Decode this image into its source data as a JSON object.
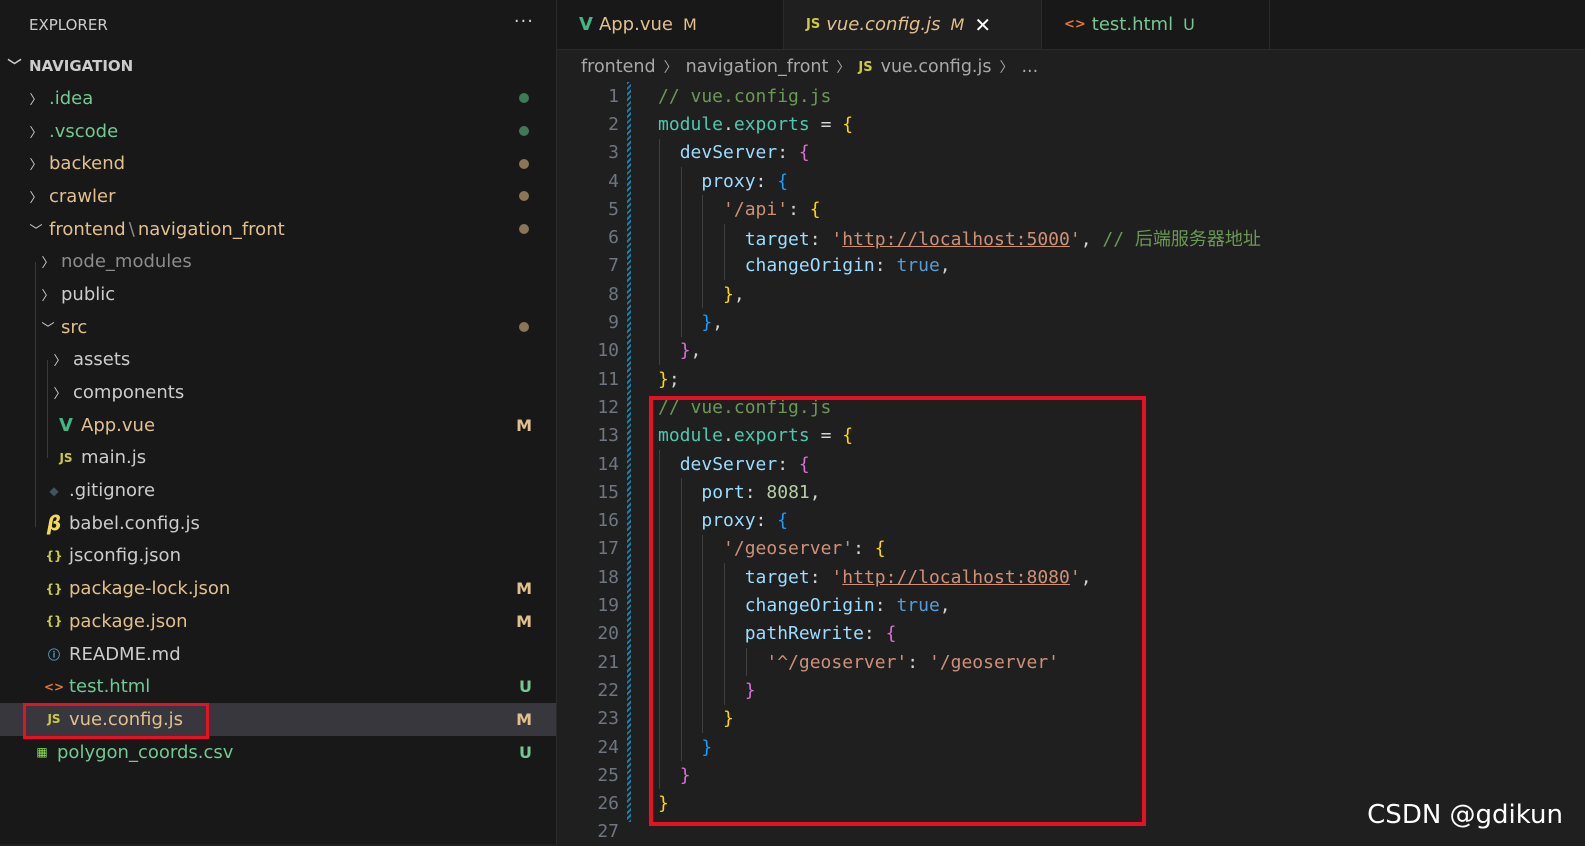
{
  "explorer": {
    "title": "EXPLORER",
    "more": "···",
    "section": "NAVIGATION",
    "items": [
      {
        "label": ".idea",
        "type": "folder",
        "depth": 0,
        "expanded": false,
        "color": "#73c991",
        "status": "dot",
        "status_color": "#3f7a56"
      },
      {
        "label": ".vscode",
        "type": "folder",
        "depth": 0,
        "expanded": false,
        "color": "#73c991",
        "status": "dot",
        "status_color": "#3f7a56"
      },
      {
        "label": "backend",
        "type": "folder",
        "depth": 0,
        "expanded": false,
        "color": "#e2c08d",
        "status": "dot",
        "status_color": "#8a7556"
      },
      {
        "label": "crawler",
        "type": "folder",
        "depth": 0,
        "expanded": false,
        "color": "#e2c08d",
        "status": "dot",
        "status_color": "#8a7556"
      },
      {
        "label": "frontend",
        "label2": "navigation_front",
        "type": "folder",
        "depth": 0,
        "expanded": true,
        "color": "#e2c08d",
        "status": "dot",
        "status_color": "#8a7556"
      },
      {
        "label": "node_modules",
        "type": "folder",
        "depth": 1,
        "expanded": false,
        "color": "#8c8c8c"
      },
      {
        "label": "public",
        "type": "folder",
        "depth": 1,
        "expanded": false,
        "color": "#cccccc"
      },
      {
        "label": "src",
        "type": "folder",
        "depth": 1,
        "expanded": true,
        "color": "#e2c08d",
        "status": "dot",
        "status_color": "#8a7556"
      },
      {
        "label": "assets",
        "type": "folder",
        "depth": 2,
        "expanded": false,
        "color": "#cccccc"
      },
      {
        "label": "components",
        "type": "folder",
        "depth": 2,
        "expanded": false,
        "color": "#cccccc"
      },
      {
        "label": "App.vue",
        "type": "file",
        "icon": "vue-icon",
        "depth": 2,
        "color": "#e2c08d",
        "status": "M"
      },
      {
        "label": "main.js",
        "type": "file",
        "icon": "js-icon",
        "depth": 2,
        "color": "#cccccc"
      },
      {
        "label": ".gitignore",
        "type": "file",
        "icon": "git-icon",
        "depth": 1,
        "color": "#cccccc"
      },
      {
        "label": "babel.config.js",
        "type": "file",
        "icon": "babel-icon",
        "depth": 1,
        "color": "#cccccc"
      },
      {
        "label": "jsconfig.json",
        "type": "file",
        "icon": "json-icon",
        "depth": 1,
        "color": "#cccccc"
      },
      {
        "label": "package-lock.json",
        "type": "file",
        "icon": "json-icon",
        "depth": 1,
        "color": "#e2c08d",
        "status": "M"
      },
      {
        "label": "package.json",
        "type": "file",
        "icon": "json-icon",
        "depth": 1,
        "color": "#e2c08d",
        "status": "M"
      },
      {
        "label": "README.md",
        "type": "file",
        "icon": "info-icon",
        "depth": 1,
        "color": "#cccccc"
      },
      {
        "label": "test.html",
        "type": "file",
        "icon": "html-icon",
        "depth": 1,
        "color": "#73c991",
        "status": "U"
      },
      {
        "label": "vue.config.js",
        "type": "file",
        "icon": "js-icon",
        "depth": 1,
        "color": "#e2c08d",
        "status": "M",
        "selected": true
      },
      {
        "label": "polygon_coords.csv",
        "type": "file",
        "icon": "csv-icon",
        "depth": 0,
        "color": "#73c991",
        "status": "U"
      }
    ]
  },
  "tabs": [
    {
      "label": "App.vue",
      "icon": "vue-icon",
      "badge": "M",
      "active": false,
      "color": "#e2c08d"
    },
    {
      "label": "vue.config.js",
      "icon": "js-icon",
      "badge": "M",
      "active": true,
      "color": "#e2c08d",
      "close": "✕"
    },
    {
      "label": "test.html",
      "icon": "html-icon",
      "badge": "U",
      "active": false,
      "color": "#73c991"
    }
  ],
  "breadcrumb": {
    "parts": [
      "frontend",
      "navigation_front"
    ],
    "file": "vue.config.js",
    "js_label": "JS",
    "tail": "..."
  },
  "editor": {
    "lines": [
      [
        [
          "c-com",
          "// vue.config.js"
        ]
      ],
      [
        [
          "c-var",
          "module"
        ],
        [
          "c-op",
          "."
        ],
        [
          "c-var",
          "exports"
        ],
        [
          "c-op",
          " = "
        ],
        [
          "b1",
          "{"
        ]
      ],
      [
        [
          "c-op",
          "  "
        ],
        [
          "c-prop",
          "devServer"
        ],
        [
          "c-op",
          ": "
        ],
        [
          "b2",
          "{"
        ]
      ],
      [
        [
          "c-op",
          "    "
        ],
        [
          "c-prop",
          "proxy"
        ],
        [
          "c-op",
          ": "
        ],
        [
          "b3",
          "{"
        ]
      ],
      [
        [
          "c-op",
          "      "
        ],
        [
          "c-str",
          "'/api'"
        ],
        [
          "c-op",
          ": "
        ],
        [
          "b1",
          "{"
        ]
      ],
      [
        [
          "c-op",
          "        "
        ],
        [
          "c-prop",
          "target"
        ],
        [
          "c-op",
          ": "
        ],
        [
          "c-str",
          "'"
        ],
        [
          "c-url",
          "http://localhost:5000"
        ],
        [
          "c-str",
          "'"
        ],
        [
          "c-op",
          ", "
        ],
        [
          "c-com",
          "// 后端服务器地址"
        ]
      ],
      [
        [
          "c-op",
          "        "
        ],
        [
          "c-prop",
          "changeOrigin"
        ],
        [
          "c-op",
          ": "
        ],
        [
          "c-kw",
          "true"
        ],
        [
          "c-op",
          ","
        ]
      ],
      [
        [
          "c-op",
          "      "
        ],
        [
          "b1",
          "}"
        ],
        [
          "c-op",
          ","
        ]
      ],
      [
        [
          "c-op",
          "    "
        ],
        [
          "b3",
          "}"
        ],
        [
          "c-op",
          ","
        ]
      ],
      [
        [
          "c-op",
          "  "
        ],
        [
          "b2",
          "}"
        ],
        [
          "c-op",
          ","
        ]
      ],
      [
        [
          "b1",
          "}"
        ],
        [
          "c-op",
          ";"
        ]
      ],
      [
        [
          "c-com",
          "// vue.config.js"
        ]
      ],
      [
        [
          "c-var",
          "module"
        ],
        [
          "c-op",
          "."
        ],
        [
          "c-var",
          "exports"
        ],
        [
          "c-op",
          " = "
        ],
        [
          "b1",
          "{"
        ]
      ],
      [
        [
          "c-op",
          "  "
        ],
        [
          "c-prop",
          "devServer"
        ],
        [
          "c-op",
          ": "
        ],
        [
          "b2",
          "{"
        ]
      ],
      [
        [
          "c-op",
          "    "
        ],
        [
          "c-prop",
          "port"
        ],
        [
          "c-op",
          ": "
        ],
        [
          "c-num",
          "8081"
        ],
        [
          "c-op",
          ","
        ]
      ],
      [
        [
          "c-op",
          "    "
        ],
        [
          "c-prop",
          "proxy"
        ],
        [
          "c-op",
          ": "
        ],
        [
          "b3",
          "{"
        ]
      ],
      [
        [
          "c-op",
          "      "
        ],
        [
          "c-str",
          "'/geoserver'"
        ],
        [
          "c-op",
          ": "
        ],
        [
          "b1",
          "{"
        ]
      ],
      [
        [
          "c-op",
          "        "
        ],
        [
          "c-prop",
          "target"
        ],
        [
          "c-op",
          ": "
        ],
        [
          "c-str",
          "'"
        ],
        [
          "c-url",
          "http://localhost:8080"
        ],
        [
          "c-str",
          "'"
        ],
        [
          "c-op",
          ","
        ]
      ],
      [
        [
          "c-op",
          "        "
        ],
        [
          "c-prop",
          "changeOrigin"
        ],
        [
          "c-op",
          ": "
        ],
        [
          "c-kw",
          "true"
        ],
        [
          "c-op",
          ","
        ]
      ],
      [
        [
          "c-op",
          "        "
        ],
        [
          "c-prop",
          "pathRewrite"
        ],
        [
          "c-op",
          ": "
        ],
        [
          "b2",
          "{"
        ]
      ],
      [
        [
          "c-op",
          "          "
        ],
        [
          "c-str",
          "'^/geoserver'"
        ],
        [
          "c-op",
          ": "
        ],
        [
          "c-str",
          "'/geoserver'"
        ]
      ],
      [
        [
          "c-op",
          "        "
        ],
        [
          "b2",
          "}"
        ]
      ],
      [
        [
          "c-op",
          "      "
        ],
        [
          "b1",
          "}"
        ]
      ],
      [
        [
          "c-op",
          "    "
        ],
        [
          "b3",
          "}"
        ]
      ],
      [
        [
          "c-op",
          "  "
        ],
        [
          "b2",
          "}"
        ]
      ],
      [
        [
          "b1",
          "}"
        ]
      ],
      []
    ]
  },
  "watermark": "CSDN @gdikun",
  "colors": {
    "highlight_box": "#e81123"
  }
}
